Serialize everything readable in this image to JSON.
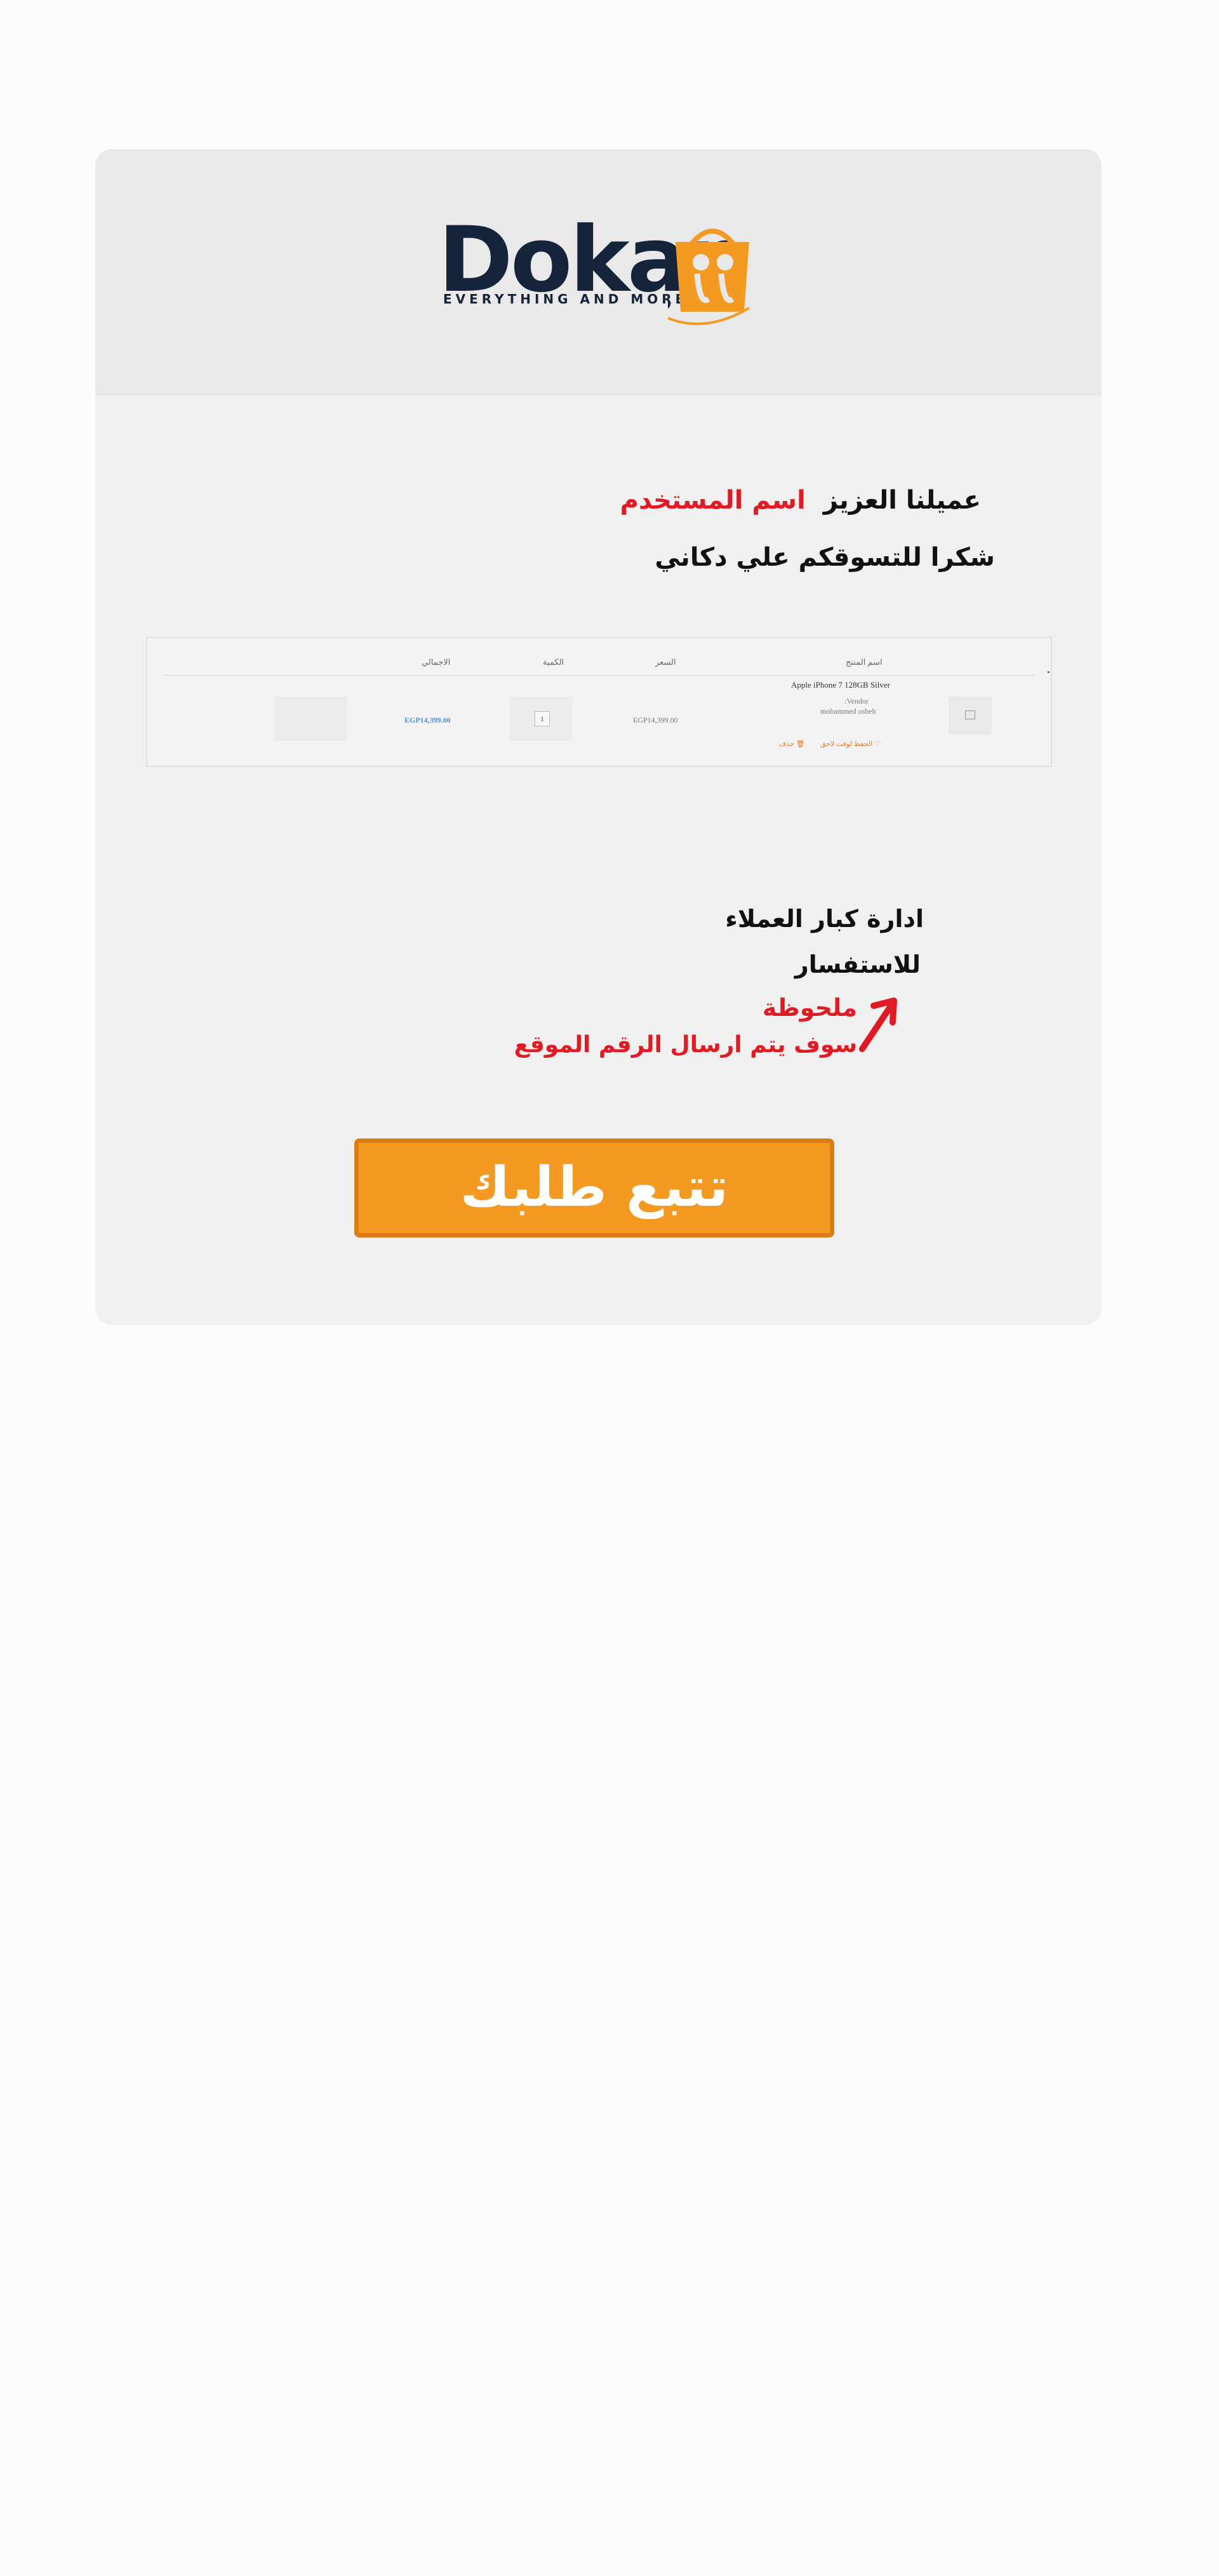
{
  "brand": {
    "name": "Dokan",
    "tagline": "EVERYTHING AND MORE",
    "colors": {
      "navy": "#16243b",
      "orange": "#f49a23"
    }
  },
  "greeting": {
    "prefix": "عميلنا العزيز",
    "username": "اسم المستخدم",
    "thanks": "شكرا للتسوقكم علي دكاني"
  },
  "cart_table": {
    "headers": [
      "اسم المنتج",
      "السعر",
      "الكمية",
      "الاجمالي"
    ],
    "row": {
      "product_name": "Apple iPhone 7 128GB Silver",
      "vendor_label": ":Vendor",
      "vendor_name": "mohammed osbeh",
      "price": "EGP14,399.00",
      "quantity": "1",
      "total": "EGP14,399.00",
      "save_later": "الحفظ لوقت لاحق",
      "remove": "حذف"
    }
  },
  "contact": {
    "vip_management": "ادارة كبار العملاء",
    "inquiry": "للاستفسار",
    "note_title": "ملحوظة",
    "note_body": "سوف يتم ارسال الرقم  الموقع"
  },
  "cta": {
    "track_order": "تتبع طلبك"
  },
  "colors": {
    "accent_red": "#e01b24",
    "button_orange": "#f49a23",
    "button_border": "#db7b14"
  }
}
